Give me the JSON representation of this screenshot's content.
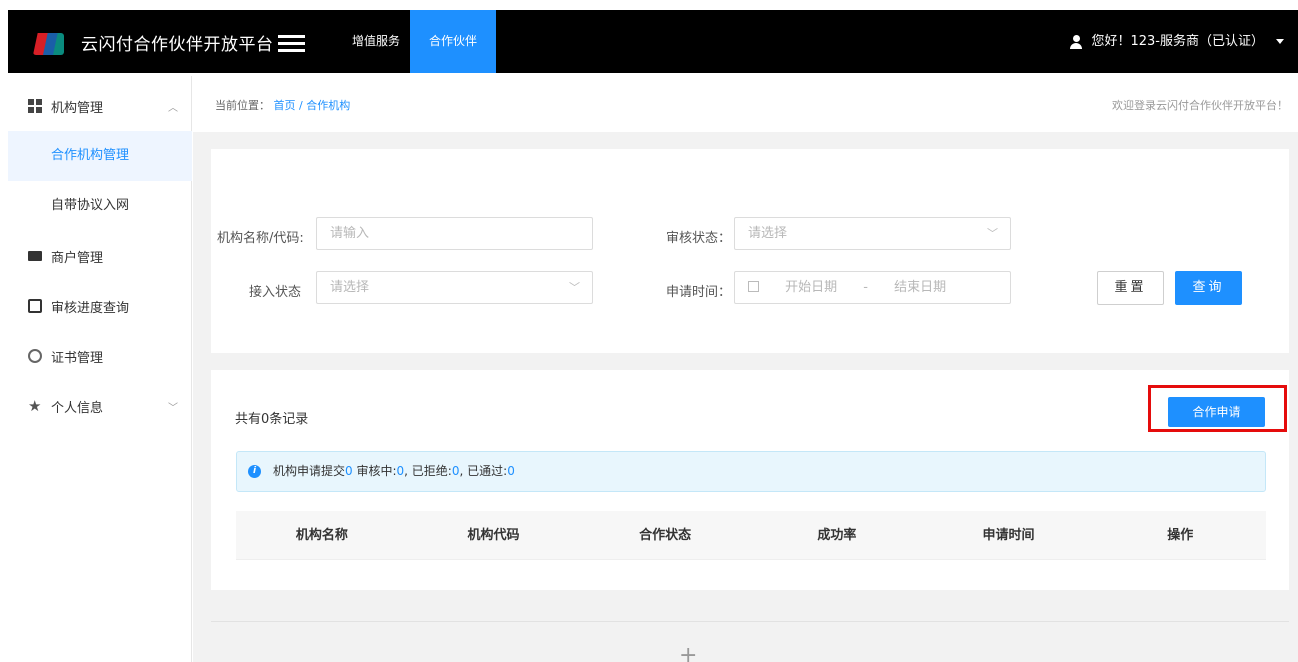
{
  "header": {
    "app_title": "云闪付合作伙伴开放平台",
    "nav": [
      {
        "label": "增值服务"
      },
      {
        "label": "合作伙伴"
      }
    ],
    "user_greeting": "您好！123-服务商（已认证）"
  },
  "sidebar": {
    "items": [
      {
        "label": "机构管理",
        "icon": "grid-icon",
        "expanded": true
      },
      {
        "label": "合作机构管理",
        "active": true
      },
      {
        "label": "自带协议入网"
      },
      {
        "label": "商户管理",
        "icon": "shop-icon"
      },
      {
        "label": "审核进度查询",
        "icon": "document-icon"
      },
      {
        "label": "证书管理",
        "icon": "certificate-icon"
      },
      {
        "label": "个人信息",
        "icon": "star-icon"
      }
    ]
  },
  "breadcrumb": {
    "prefix": "当前位置：",
    "home": "首页",
    "separator": "/",
    "current": "合作机构"
  },
  "welcome": "欢迎登录云闪付合作伙伴开放平台！",
  "search": {
    "org_label": "机构名称/代码:",
    "org_placeholder": "请输入",
    "review_label": "审核状态：",
    "review_placeholder": "请选择",
    "access_label": "接入状态",
    "access_placeholder": "请选择",
    "date_label": "申请时间：",
    "date_start": "开始日期",
    "date_sep": "-",
    "date_end": "结束日期",
    "reset_label": "重置",
    "query_label": "查询"
  },
  "list": {
    "record_count": "共有0条记录",
    "apply_label": "合作申请",
    "info": {
      "submitted_label": "机构申请提交",
      "submitted": "0",
      "reviewing_label": "审核中:",
      "reviewing": "0",
      "rejected_label": ", 已拒绝:",
      "rejected": "0",
      "passed_label": ", 已通过:",
      "passed": "0"
    },
    "columns": [
      "机构名称",
      "机构代码",
      "合作状态",
      "成功率",
      "申请时间",
      "操作"
    ]
  },
  "colors": {
    "accent": "#1e90ff",
    "highlight": "#e50c0c",
    "topbar": "#000000"
  }
}
